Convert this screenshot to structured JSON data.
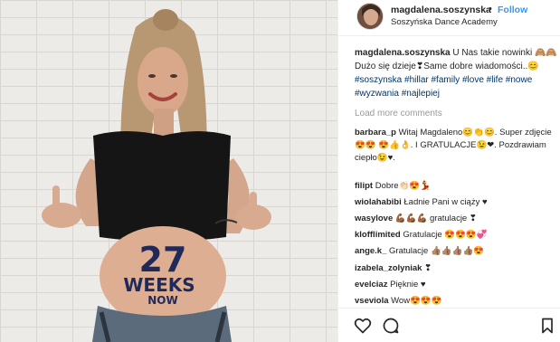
{
  "post": {
    "username": "magdalena.soszynska",
    "dot": "•",
    "follow_label": "Follow",
    "location": "Soszyńska Dance Academy",
    "caption_user": "magdalena.soszynska",
    "caption_text": "U Nas takie nowinki 🙈🙈 Dużo się dzieje❣Same dobre wiadomości..😊",
    "hashtags": [
      "#soszynska",
      "#hillar",
      "#family",
      "#love",
      "#life",
      "#nowe",
      "#wyzwania",
      "#najlepiej"
    ],
    "load_more": "Load more comments"
  },
  "photo": {
    "belly_number": "27",
    "belly_word1": "WEEKS",
    "belly_word2": "NOW"
  },
  "comments": [
    {
      "user": "barbara_p",
      "text": "Witaj Magdaleno😊👏😊. Super zdjęcie😍😍 😍👍👌. I GRATULACJE😉❤. Pozdrawiam ciepło😉♥."
    },
    {
      "user": "filipt",
      "text": "Dobre👏🏻😍💃"
    },
    {
      "user": "wiolahabibi",
      "text": "Ładnie Pani w ciąży ♥"
    },
    {
      "user": "wasylove",
      "text": "💪🏾💪🏾💪🏾 gratulacje ❣"
    },
    {
      "user": "klofflimited",
      "text": "Gratulacje 😍😍😍💞"
    },
    {
      "user": "ange.k_",
      "text": "Gratulacje 👍🏽👍🏽👍🏽👍🏽😍"
    },
    {
      "user": "izabela_zolyniak",
      "text": "❣"
    },
    {
      "user": "evelciaz",
      "text": "Pięknie ♥"
    },
    {
      "user": "vseviola",
      "text": "Wow😍😍😍"
    }
  ],
  "icons": [
    "heart-icon",
    "comment-icon",
    "bookmark-icon"
  ]
}
